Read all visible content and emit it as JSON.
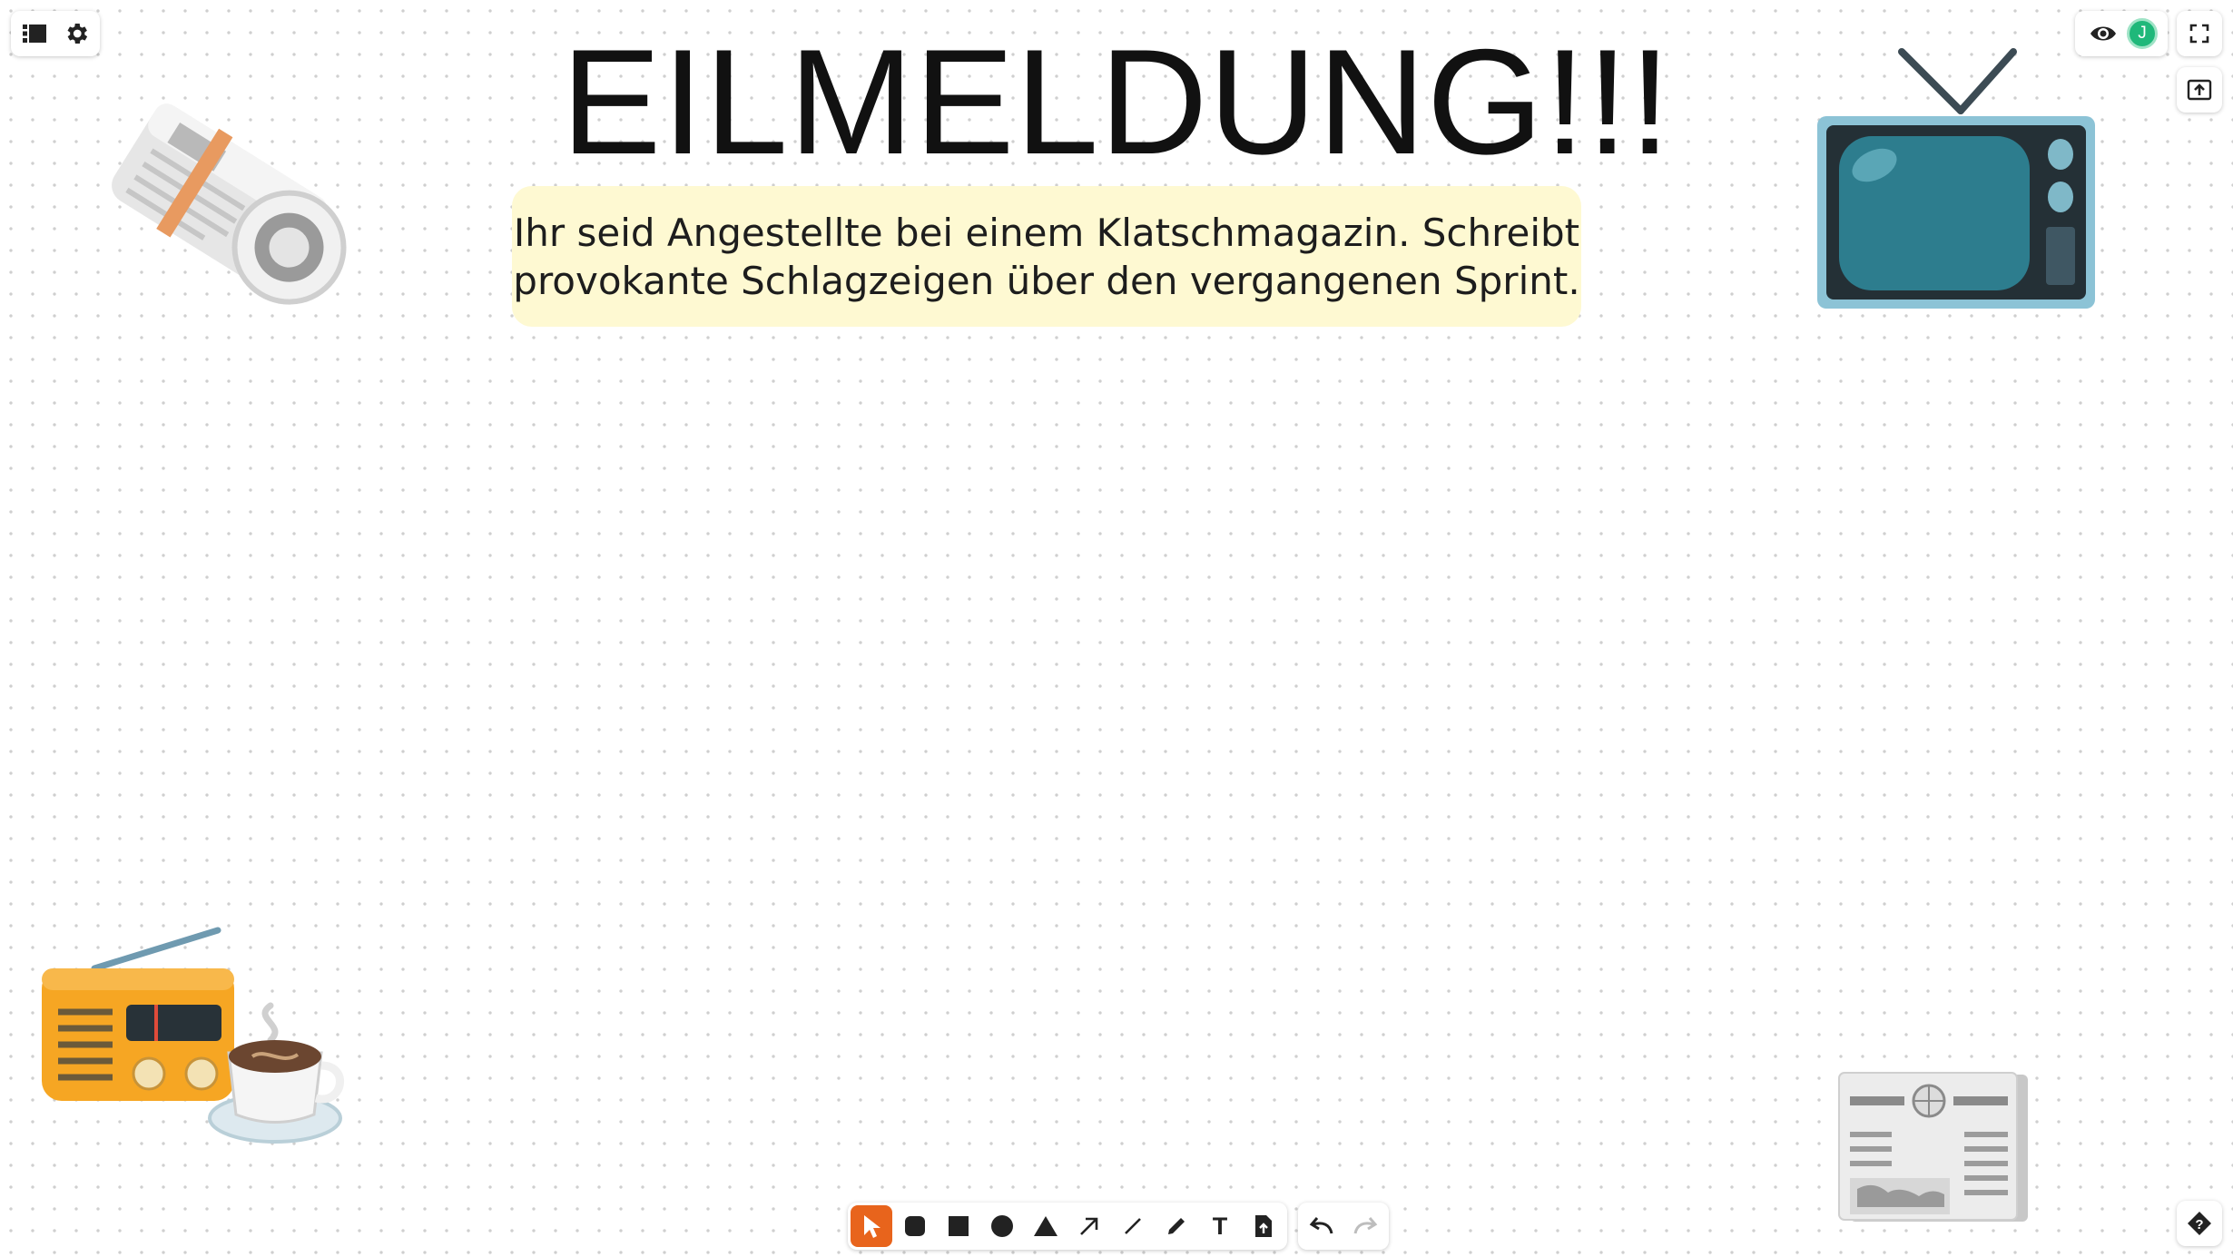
{
  "canvas": {
    "title": "EILMELDUNG!!!",
    "note": {
      "line1": "Ihr seid Angestellte bei einem Klatschmagazin. Schreibt",
      "line2": "provokante Schlagzeigen über den vergangenen Sprint.",
      "color": "#fef9d2"
    }
  },
  "topbar_left": {
    "icons": [
      "list-icon",
      "gear-icon"
    ]
  },
  "topbar_right": {
    "icons": [
      "eye-icon",
      "fullscreen-icon",
      "upload-icon"
    ],
    "avatar": {
      "initial": "J",
      "color": "#1fb87a"
    }
  },
  "toolbar": {
    "tools": [
      "select",
      "rounded-rectangle",
      "rectangle",
      "circle",
      "triangle",
      "arrow",
      "line",
      "pen",
      "text",
      "file"
    ],
    "active": "select",
    "accent": "#e8641c",
    "text_tool_glyph": "T"
  },
  "help": {
    "icon": "help-icon"
  }
}
